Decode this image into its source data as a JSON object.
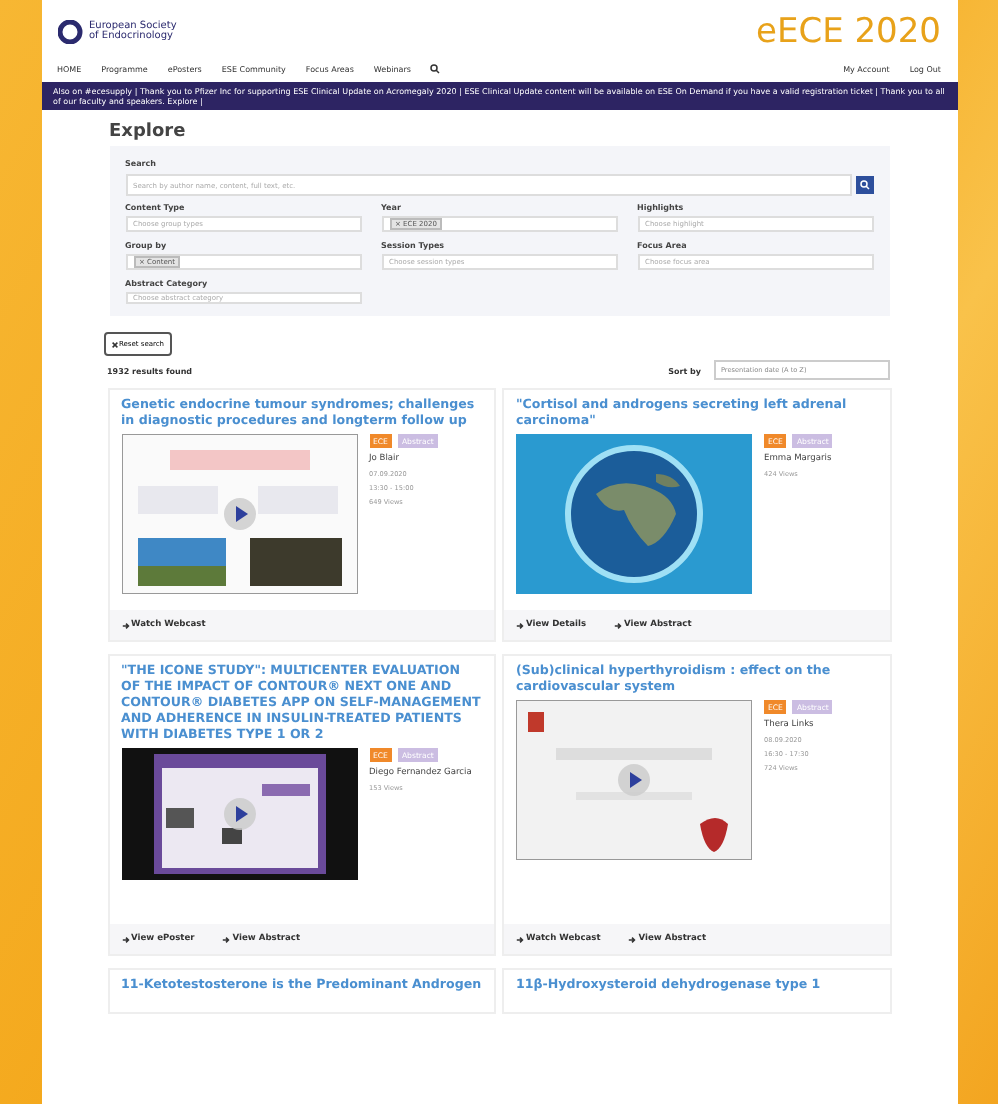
{
  "header": {
    "logo_lines": [
      "European Society",
      "of Endocrinology"
    ],
    "brand": "eECE 2020"
  },
  "nav": {
    "items": [
      "HOME",
      "Programme",
      "ePosters",
      "ESE Community",
      "Focus Areas",
      "Webinars"
    ],
    "account": [
      "My Account",
      "Log Out"
    ]
  },
  "banner": "Also on #ecesupply | Thank you to Pfizer Inc for supporting ESE Clinical Update on Acromegaly 2020 | ESE Clinical Update content will be available on ESE On Demand if you have a valid registration ticket | Thank you to all of our faculty and speakers. Explore |",
  "page_title": "Explore",
  "filters": {
    "search_label": "Search",
    "search_placeholder": "Search by author name, content, full text, etc.",
    "fields": [
      {
        "label": "Content Type",
        "placeholder": "Choose group types"
      },
      {
        "label": "Year",
        "chip": "× ECE 2020"
      },
      {
        "label": "Highlights",
        "placeholder": "Choose highlight"
      },
      {
        "label": "Group by",
        "chip": "× Content"
      },
      {
        "label": "Session Types",
        "placeholder": "Choose session types"
      },
      {
        "label": "Focus Area",
        "placeholder": "Choose focus area"
      },
      {
        "label": "Abstract Category",
        "placeholder": "Choose abstract category"
      }
    ]
  },
  "reset_button": "Reset search",
  "results_count": "1932 results found",
  "sort": {
    "label": "Sort by",
    "value": "Presentation date (A to Z)"
  },
  "cards": [
    {
      "title": "Genetic endocrine tumour syndromes; challenges in diagnostic procedures and longterm follow up",
      "play": true,
      "tags": [
        {
          "label": "ECE",
          "color": "#f0892a"
        },
        {
          "label": "Abstract",
          "color": "#cbbde2"
        }
      ],
      "author": "Jo Blair",
      "meta": [
        "07.09.2020",
        "13:30 - 15:00"
      ],
      "views": "649 Views",
      "actions": [
        "Watch Webcast"
      ]
    },
    {
      "title": "\"Cortisol and androgens secreting left adrenal carcinoma\"",
      "play": false,
      "tags": [
        {
          "label": "ECE",
          "color": "#f0892a"
        },
        {
          "label": "Abstract",
          "color": "#cbbde2"
        }
      ],
      "author": "Emma Margaris",
      "views": "424 Views",
      "actions": [
        "View Details",
        "View Abstract"
      ]
    },
    {
      "title": "\"THE ICONE STUDY\": MULTICENTER EVALUATION OF THE IMPACT OF CONTOUR® NEXT ONE AND CONTOUR® DIABETES APP ON SELF-MANAGEMENT AND ADHERENCE IN INSULIN-TREATED PATIENTS WITH DIABETES TYPE 1 OR 2",
      "play": true,
      "tags": [
        {
          "label": "ECE",
          "color": "#f0892a"
        },
        {
          "label": "Abstract",
          "color": "#cbbde2"
        }
      ],
      "author": "Diego Fernandez Garcia",
      "views": "153 Views",
      "actions": [
        "View ePoster",
        "View Abstract"
      ]
    },
    {
      "title": "(Sub)clinical hyperthyroidism : effect on the cardiovascular system",
      "play": true,
      "tags": [
        {
          "label": "ECE",
          "color": "#f0892a"
        },
        {
          "label": "Abstract",
          "color": "#cbbde2"
        }
      ],
      "author": "Thera Links",
      "meta": [
        "08.09.2020",
        "16:30 - 17:30"
      ],
      "views": "724 Views",
      "actions": [
        "Watch Webcast",
        "View Abstract"
      ]
    }
  ],
  "more_titles": [
    "11-Ketotestosterone is the Predominant Androgen",
    "11β-Hydroxysteroid dehydrogenase type 1"
  ]
}
